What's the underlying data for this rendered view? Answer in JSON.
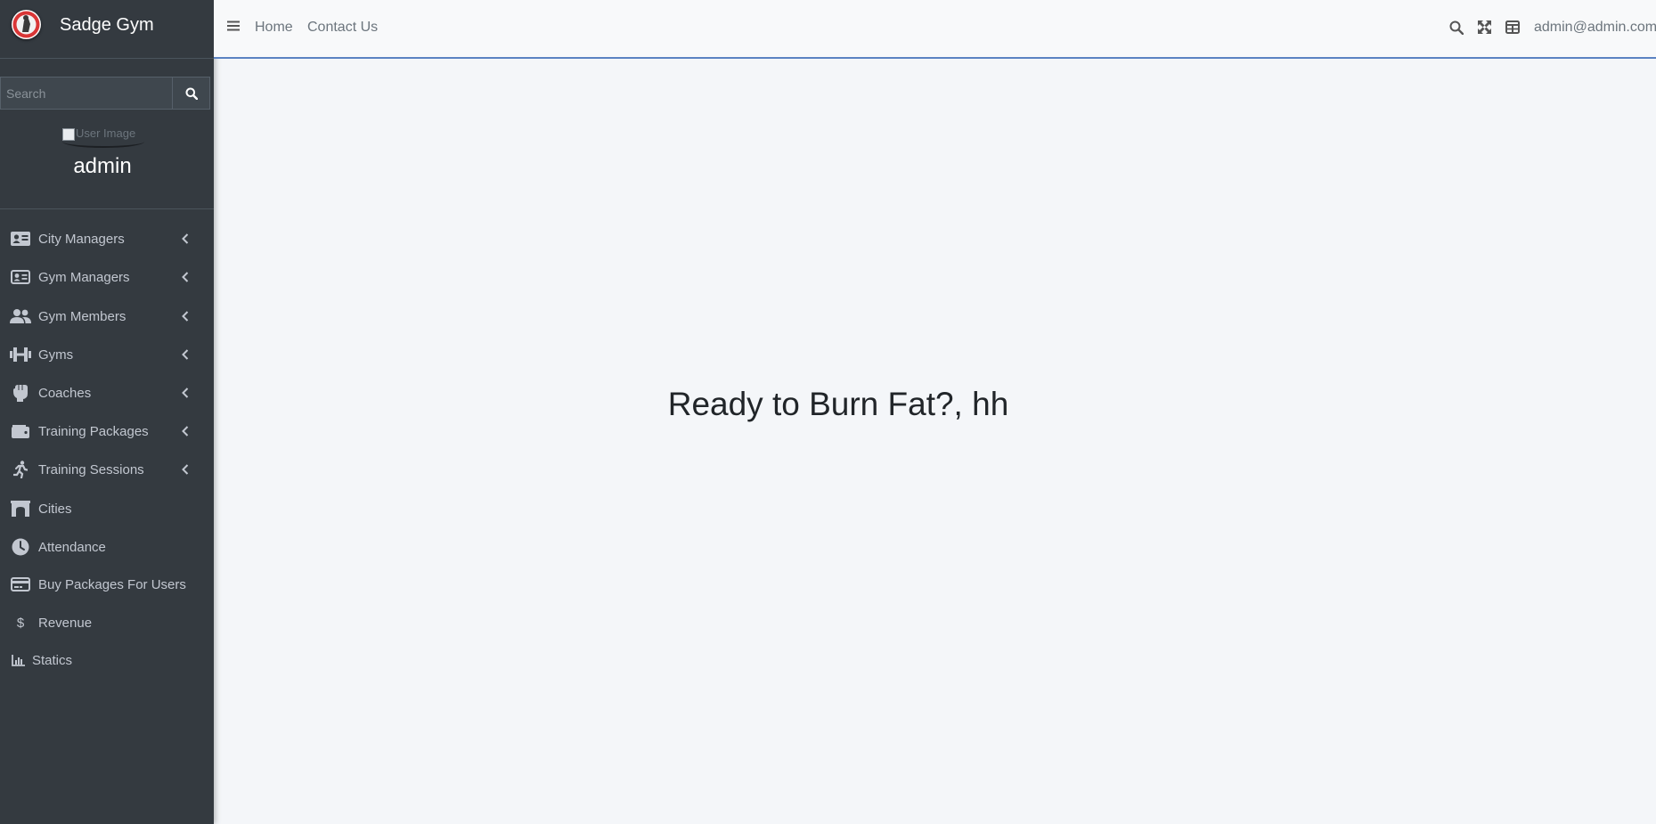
{
  "brand": {
    "name": "Sadge Gym"
  },
  "search": {
    "placeholder": "Search"
  },
  "user_panel": {
    "image_alt": "User Image",
    "name": "admin"
  },
  "sidebar": {
    "items": [
      {
        "label": "City Managers",
        "icon": "id-card-icon",
        "has_submenu": true
      },
      {
        "label": "Gym Managers",
        "icon": "id-card-icon",
        "has_submenu": true
      },
      {
        "label": "Gym Members",
        "icon": "users-icon",
        "has_submenu": true
      },
      {
        "label": "Gyms",
        "icon": "dumbbell-icon",
        "has_submenu": true
      },
      {
        "label": "Coaches",
        "icon": "fist-icon",
        "has_submenu": true
      },
      {
        "label": "Training Packages",
        "icon": "wallet-icon",
        "has_submenu": true
      },
      {
        "label": "Training Sessions",
        "icon": "running-icon",
        "has_submenu": true
      },
      {
        "label": "Cities",
        "icon": "archway-icon",
        "has_submenu": false
      },
      {
        "label": "Attendance",
        "icon": "clock-icon",
        "has_submenu": false
      },
      {
        "label": "Buy Packages For Users",
        "icon": "credit-card-icon",
        "has_submenu": false
      },
      {
        "label": "Revenue",
        "icon": "dollar-icon",
        "has_submenu": false
      },
      {
        "label": "Statics",
        "icon": "bar-chart-icon",
        "has_submenu": false
      }
    ]
  },
  "topbar": {
    "links": [
      "Home",
      "Contact Us"
    ],
    "user_email": "admin@admin.com",
    "icons": [
      "search-icon",
      "expand-icon",
      "grid-icon"
    ]
  },
  "main": {
    "headline": "Ready to Burn Fat?, hh"
  },
  "colors": {
    "sidebar_bg": "#343a40",
    "sidebar_text": "#c2c7d0",
    "content_bg": "#f4f6f9",
    "topbar_bg": "#f8f9fa",
    "topbar_border": "#5b83c2",
    "logo_red": "#d93636"
  }
}
